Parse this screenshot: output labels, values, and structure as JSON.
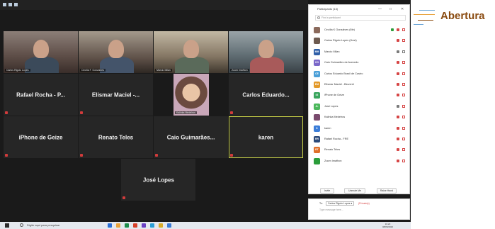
{
  "slide": {
    "heading": "Abertura",
    "heading_color": "#8a4b10",
    "line_colors": [
      "#6aa5d8",
      "#e8a33d",
      "#8a4b10"
    ]
  },
  "meeting": {
    "tiles": [
      {
        "kind": "video",
        "label": "Carlos Rigolo Lopes"
      },
      {
        "kind": "video",
        "label": "Cecília F. Gonzalves"
      },
      {
        "kind": "video",
        "label": "Marcio Milan"
      },
      {
        "kind": "video",
        "label": "Zoom Imafhon"
      },
      {
        "kind": "name",
        "name": "Rafael Rocha - P..."
      },
      {
        "kind": "name",
        "name": "Elismar Maciel -..."
      },
      {
        "kind": "video",
        "label": "Kalinka Medeiros"
      },
      {
        "kind": "name",
        "name": "Carlos Eduardo..."
      },
      {
        "kind": "name",
        "name": "iPhone de Geize"
      },
      {
        "kind": "name",
        "name": "Renato Teles"
      },
      {
        "kind": "name",
        "name": "Caio Guimarães..."
      },
      {
        "kind": "name",
        "name": "karen"
      },
      {
        "kind": "name",
        "name": "José Lopes"
      }
    ],
    "active_speaker": "karen"
  },
  "participants_panel": {
    "title": "Participants (13)",
    "search_placeholder": "Find a participant",
    "window_controls": [
      "—",
      "□",
      "✕"
    ],
    "participants": [
      {
        "name": "Cecília K Gonzalves (Me)",
        "avatar_color": "#8b6a5c",
        "initials": "",
        "sharing": true,
        "mic_muted": true,
        "cam_off": true
      },
      {
        "name": "Carlos Rigolo Lopes (Host)",
        "avatar_color": "#6d5a4f",
        "initials": "",
        "sharing": false,
        "mic_muted": true,
        "cam_off": true
      },
      {
        "name": "Marcio Milan",
        "avatar_color": "#2f5fa8",
        "initials": "MM",
        "sharing": false,
        "mic_muted": false,
        "cam_off": false
      },
      {
        "name": "Caio Guimarães de Azevedo",
        "avatar_color": "#7b68c9",
        "initials": "CG",
        "sharing": false,
        "mic_muted": true,
        "cam_off": true
      },
      {
        "name": "Carlos Eduardo Brazil de Castro",
        "avatar_color": "#4a9fd8",
        "initials": "CE",
        "sharing": false,
        "mic_muted": true,
        "cam_off": true
      },
      {
        "name": "Elismar Maciel - Bioventi",
        "avatar_color": "#e39a2b",
        "initials": "EM",
        "sharing": false,
        "mic_muted": true,
        "cam_off": true
      },
      {
        "name": "iPhone de Geize",
        "avatar_color": "#3aa55d",
        "initials": "iG",
        "sharing": false,
        "mic_muted": true,
        "cam_off": true
      },
      {
        "name": "José Lopes",
        "avatar_color": "#4cb85c",
        "initials": "JL",
        "sharing": false,
        "mic_muted": false,
        "cam_off": true
      },
      {
        "name": "Kalinka Medeiros",
        "avatar_color": "#7a4b6e",
        "initials": "",
        "sharing": false,
        "mic_muted": true,
        "cam_off": true
      },
      {
        "name": "karen",
        "avatar_color": "#3b7dd8",
        "initials": "K",
        "sharing": false,
        "mic_muted": true,
        "cam_off": true
      },
      {
        "name": "Rafael Rocha - FRE",
        "avatar_color": "#2c4a7a",
        "initials": "RR",
        "sharing": false,
        "mic_muted": true,
        "cam_off": true
      },
      {
        "name": "Renato Teles",
        "avatar_color": "#e0702a",
        "initials": "RT",
        "sharing": false,
        "mic_muted": true,
        "cam_off": true
      },
      {
        "name": "Zoom Imafhon",
        "avatar_color": "#2a9d3a",
        "initials": "",
        "sharing": false,
        "mic_muted": true,
        "cam_off": true
      }
    ],
    "actions": [
      "Invite",
      "Unmute Me",
      "Raise Hand"
    ]
  },
  "chat": {
    "to_label": "To:",
    "recipient": "Carlos Rigolo Lopes ▾",
    "privacy": "(Privately)",
    "placeholder": "Type message here..."
  },
  "taskbar": {
    "search_text": "Digite aqui para pesquisar",
    "time": "19:23",
    "date": "08/05/2020",
    "app_colors": [
      "#2a6fd6",
      "#e8a33d",
      "#1e8b4a",
      "#d6402a",
      "#6a3fc4",
      "#2a9fd6",
      "#d9ad2a",
      "#3a7bd5"
    ]
  }
}
